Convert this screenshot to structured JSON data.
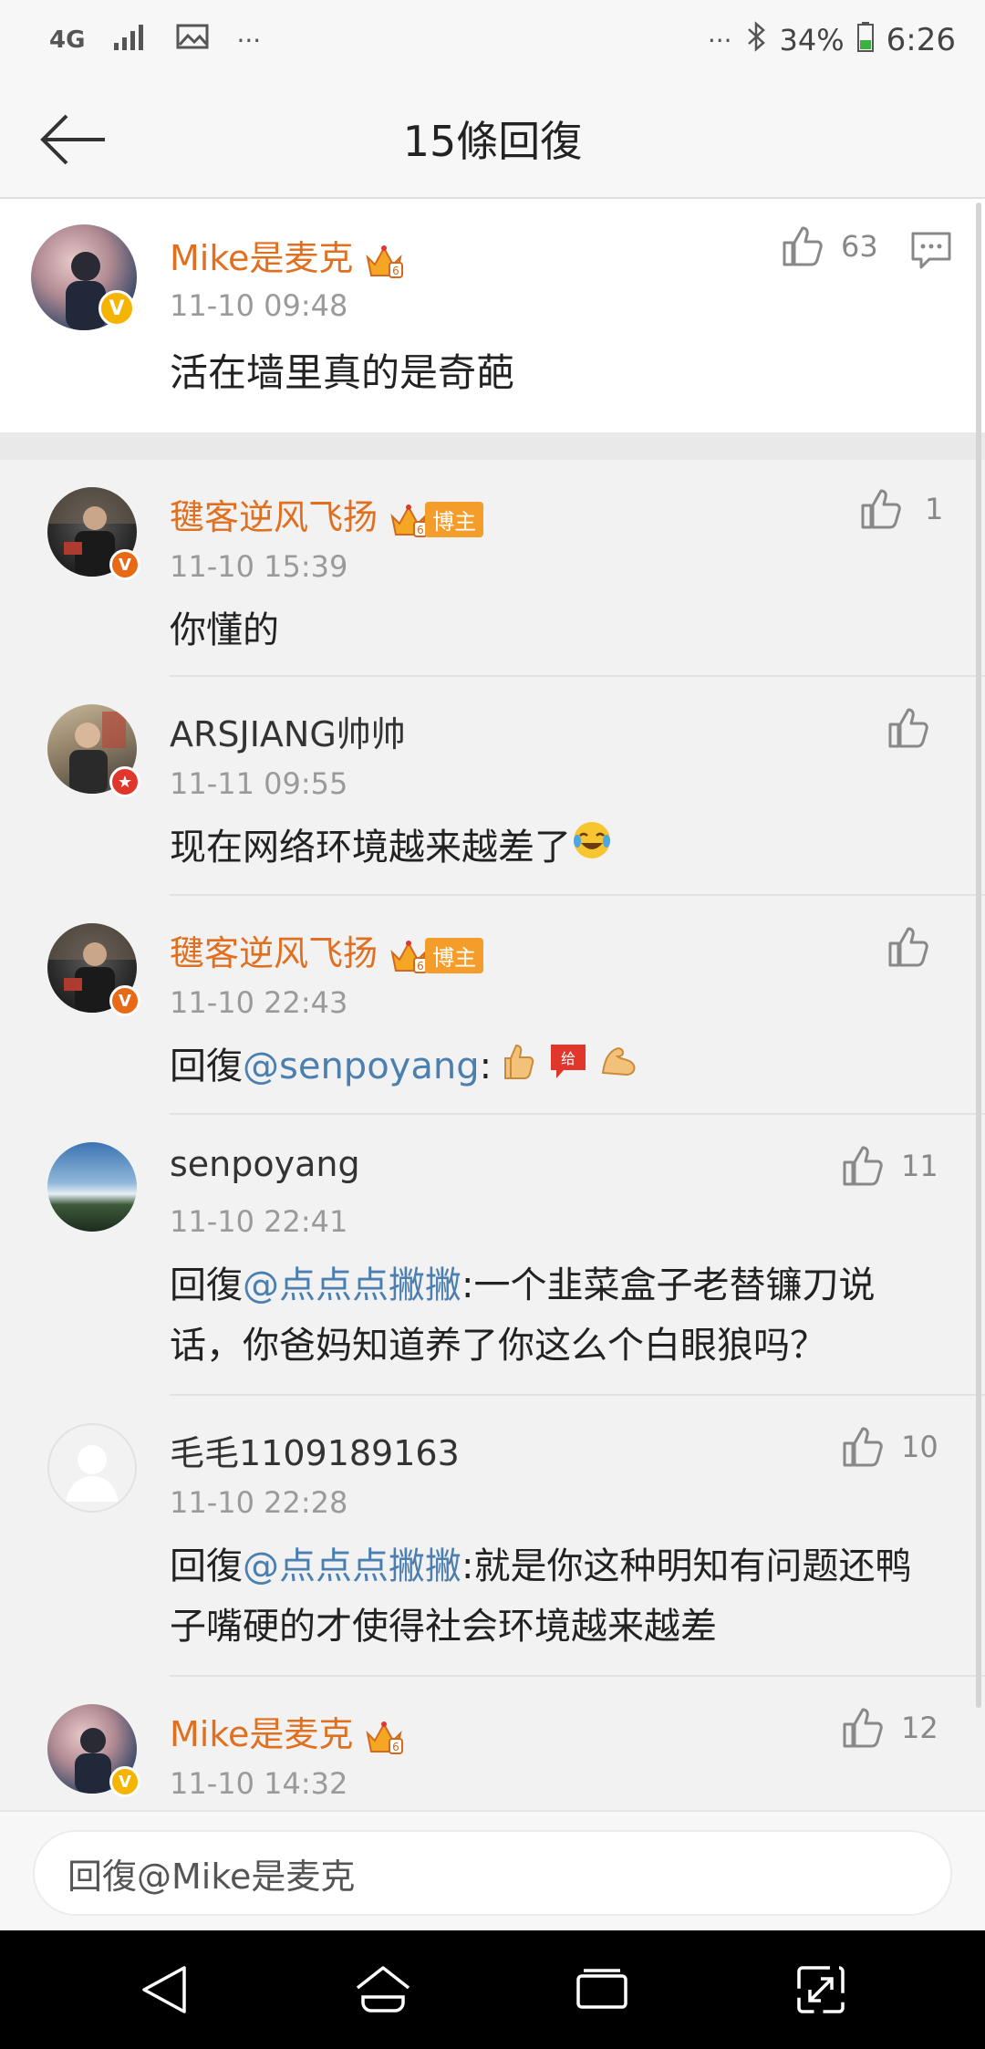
{
  "status": {
    "network": "4G",
    "battery": "34%",
    "time": "6:26"
  },
  "header": {
    "title": "15條回復"
  },
  "main_comment": {
    "username": "Mike是麦克",
    "time": "11-10 09:48",
    "text": "活在墙里真的是奇葩",
    "likes": "63"
  },
  "replies": [
    {
      "username": "毽客逆风飞扬",
      "blogger_tag": "博主",
      "time": "11-10 15:39",
      "text": "你懂的",
      "likes": "1"
    },
    {
      "username": "ARSJIANG帅帅",
      "time": "11-11 09:55",
      "text": "现在网络环境越来越差了",
      "likes": ""
    },
    {
      "username": "毽客逆风飞扬",
      "blogger_tag": "博主",
      "time": "11-10 22:43",
      "reply_prefix": "回復",
      "mention": "@senpoyang",
      "text": ":",
      "likes": ""
    },
    {
      "username": "senpoyang",
      "time": "11-10 22:41",
      "reply_prefix": "回復",
      "mention": "@点点点撇撇",
      "text": ":一个韭菜盒子老替镰刀说话，你爸妈知道养了你这么个白眼狼吗？",
      "likes": "11"
    },
    {
      "username": "毛毛1109189163",
      "time": "11-10 22:28",
      "reply_prefix": "回復",
      "mention": "@点点点撇撇",
      "text": ":就是你这种明知有问题还鸭子嘴硬的才使得社会环境越来越差",
      "likes": "10"
    },
    {
      "username": "Mike是麦克",
      "time": "11-10 14:32",
      "likes": "12"
    }
  ],
  "input": {
    "placeholder": "回復@Mike是麦克"
  },
  "colors": {
    "username_orange": "#e0701f",
    "mention_blue": "#4a7fb0",
    "verified_gold": "#f5b400",
    "verified_orange": "#e86a17",
    "verified_red": "#e0362c"
  }
}
